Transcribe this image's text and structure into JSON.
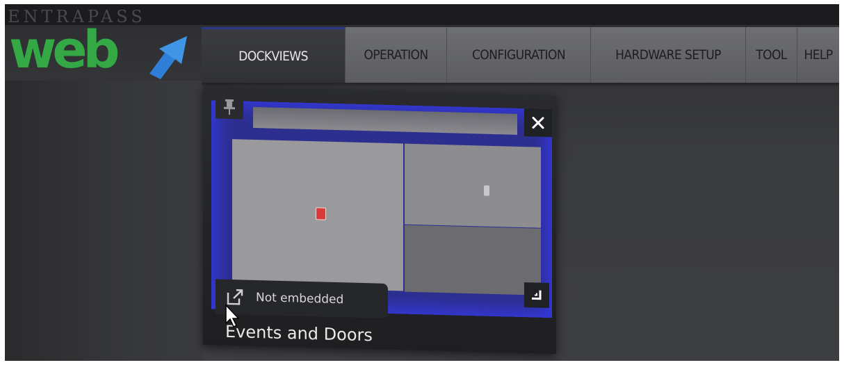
{
  "branding": {
    "top_text": "ENTRAPASS",
    "main_text": "web",
    "green": "#33a844",
    "blue": "#2f7fd8"
  },
  "menu": {
    "items": [
      {
        "label": "DOCKVIEWS",
        "active": true
      },
      {
        "label": "OPERATION",
        "active": false
      },
      {
        "label": "CONFIGURATION",
        "active": false
      },
      {
        "label": "HARDWARE SETUP",
        "active": false
      },
      {
        "label": "TOOL",
        "active": false
      },
      {
        "label": "HELP",
        "active": false
      }
    ]
  },
  "dockview": {
    "title": "Events and Doors",
    "embed_status": "Not embedded",
    "icons": {
      "pin": "pin-icon",
      "close": "close-icon",
      "resize": "resize-icon",
      "embed": "external-link-icon"
    },
    "highlight_color": "#3438d8"
  }
}
